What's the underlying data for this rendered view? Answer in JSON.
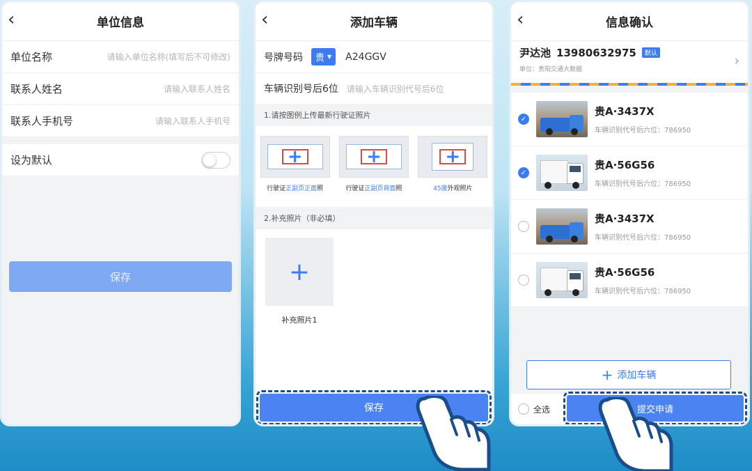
{
  "colors": {
    "accent": "#4b84f2",
    "save_disabled": "#7fa9f2",
    "badge": "#3d7cf0"
  },
  "panel1": {
    "title": "单位信息",
    "fields": [
      {
        "label": "单位名称",
        "placeholder": "请输入单位名称(填写后不可修改)"
      },
      {
        "label": "联系人姓名",
        "placeholder": "请输入联系人姓名"
      },
      {
        "label": "联系人手机号",
        "placeholder": "请输入联系人手机号"
      }
    ],
    "default_label": "设为默认",
    "save_label": "保存"
  },
  "panel2": {
    "title": "添加车辆",
    "plate_label": "号牌号码",
    "province": "贵",
    "plate_value": "A24GGV",
    "vin_label": "车辆识别号后6位",
    "vin_placeholder": "请输入车辆识别代号后6位",
    "section1": "1.请按图例上传最新行驶证照片",
    "uploads": [
      {
        "pre": "行驶证",
        "hl": "正副页正面",
        "post": "照"
      },
      {
        "pre": "行驶证",
        "hl": "正副页背面",
        "post": "照"
      },
      {
        "pre": "",
        "hl": "45度",
        "post": "外观照片"
      }
    ],
    "section2": "2.补充照片（非必填）",
    "extra_caption": "补充照片1",
    "save_label": "保存"
  },
  "panel3": {
    "title": "信息确认",
    "user_name": "尹达池",
    "user_phone": "13980632975",
    "badge": "默认",
    "unit": "单位：贵阳交通大数据",
    "vehicles": [
      {
        "plate": "贵A·3437X",
        "vin_text": "车辆识别代号后六位：786950",
        "checked": true,
        "type": "blue"
      },
      {
        "plate": "贵A·56G56",
        "vin_text": "车辆识别代号后六位：786950",
        "checked": true,
        "type": "white"
      },
      {
        "plate": "贵A·3437X",
        "vin_text": "车辆识别代号后六位：786950",
        "checked": false,
        "type": "blue"
      },
      {
        "plate": "贵A·56G56",
        "vin_text": "车辆识别代号后六位：786950",
        "checked": false,
        "type": "white"
      }
    ],
    "add_label": "添加车辆",
    "select_all": "全选",
    "submit_label": "提交申请"
  }
}
